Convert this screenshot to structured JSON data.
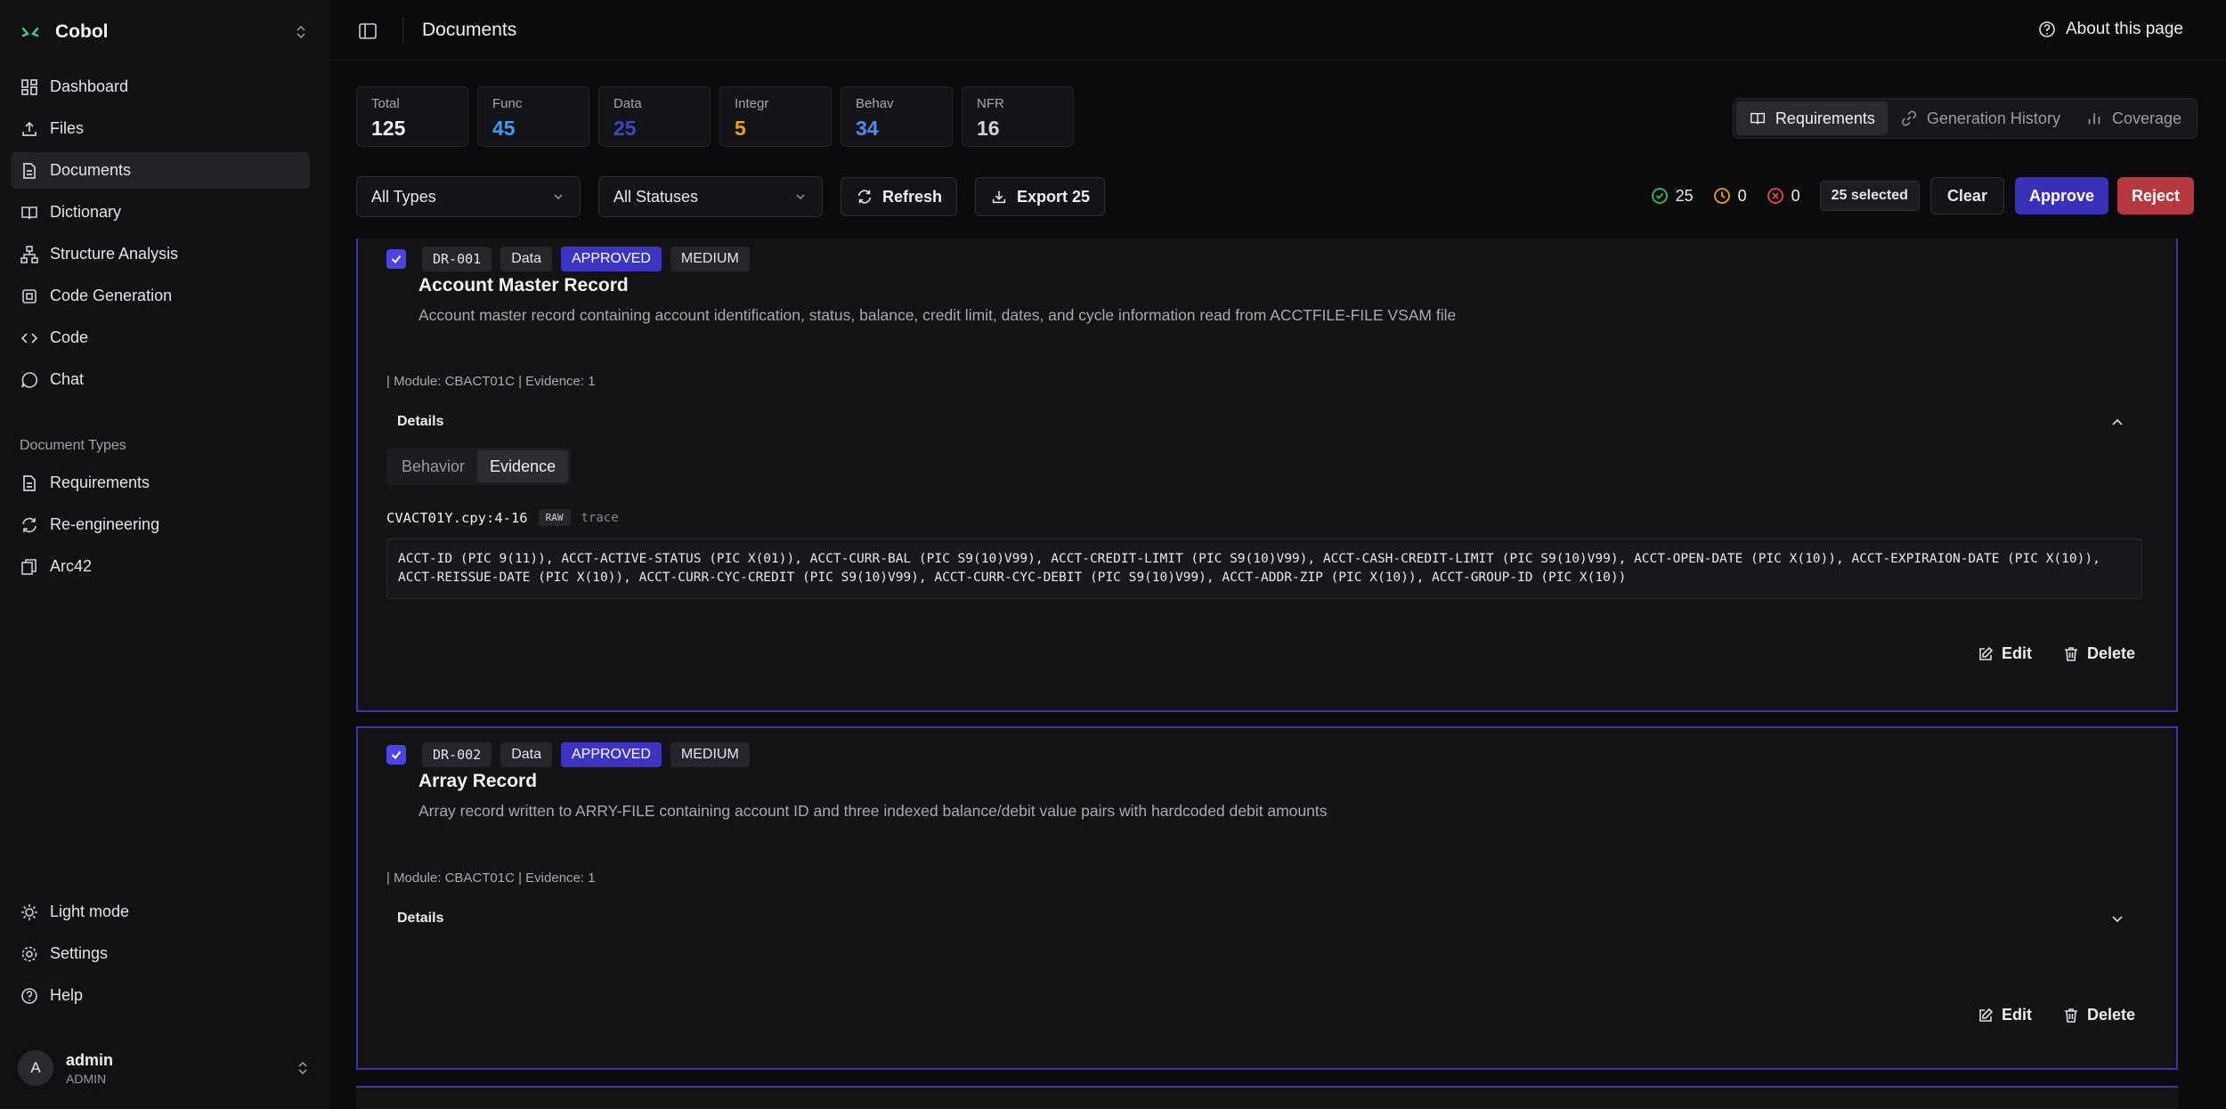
{
  "app": {
    "name": "Cobol"
  },
  "sidebar": {
    "items": [
      {
        "label": "Dashboard",
        "icon": "dashboard-icon"
      },
      {
        "label": "Files",
        "icon": "upload-icon"
      },
      {
        "label": "Documents",
        "icon": "document-icon",
        "active": true
      },
      {
        "label": "Dictionary",
        "icon": "book-icon"
      },
      {
        "label": "Structure Analysis",
        "icon": "structure-icon"
      },
      {
        "label": "Code Generation",
        "icon": "cpu-icon"
      },
      {
        "label": "Code",
        "icon": "code-icon"
      },
      {
        "label": "Chat",
        "icon": "chat-icon"
      }
    ],
    "section_label": "Document Types",
    "doc_types": [
      {
        "label": "Requirements",
        "icon": "document-icon"
      },
      {
        "label": "Re-engineering",
        "icon": "refresh-icon"
      },
      {
        "label": "Arc42",
        "icon": "layers-icon"
      }
    ],
    "bottom": [
      {
        "label": "Light mode",
        "icon": "sun-icon"
      },
      {
        "label": "Settings",
        "icon": "gear-icon"
      },
      {
        "label": "Help",
        "icon": "help-icon"
      }
    ],
    "user": {
      "initial": "A",
      "name": "admin",
      "role": "ADMIN"
    }
  },
  "header": {
    "title": "Documents",
    "about_label": "About this page"
  },
  "stats": [
    {
      "label": "Total",
      "value": "125",
      "color": "#f2f2f4"
    },
    {
      "label": "Func",
      "value": "45",
      "color": "#3b9cf0"
    },
    {
      "label": "Data",
      "value": "25",
      "color": "#3a48c8"
    },
    {
      "label": "Integr",
      "value": "5",
      "color": "#e8a21c"
    },
    {
      "label": "Behav",
      "value": "34",
      "color": "#4a8ef5"
    },
    {
      "label": "NFR",
      "value": "16",
      "color": "#d4d4d8"
    }
  ],
  "view_tabs": [
    {
      "label": "Requirements",
      "active": true
    },
    {
      "label": "Generation History"
    },
    {
      "label": "Coverage"
    }
  ],
  "filters": {
    "type_select": "All Types",
    "status_select": "All Statuses",
    "refresh_label": "Refresh",
    "export_label": "Export 25"
  },
  "bulk": {
    "approved_count": "25",
    "pending_count": "0",
    "rejected_count": "0",
    "selected_label": "25 selected",
    "clear_label": "Clear",
    "approve_label": "Approve",
    "reject_label": "Reject"
  },
  "colors": {
    "accent": "#3d34c4",
    "reject": "#b5393f",
    "approved_icon": "#2fbf5b",
    "pending_icon": "#e8a21c",
    "rejected_icon": "#e5484d"
  },
  "cards": [
    {
      "id": "DR-001",
      "type": "Data",
      "status": "APPROVED",
      "priority": "MEDIUM",
      "title": "Account Master Record",
      "description": "Account master record containing account identification, status, balance, credit limit, dates, and cycle information read from ACCTFILE-FILE VSAM file",
      "meta": "| Module: CBACT01C  | Evidence: 1",
      "details_label": "Details",
      "subtabs": [
        "Behavior",
        "Evidence"
      ],
      "evidence_file": "CVACT01Y.cpy:4-16",
      "evidence_raw": "RAW",
      "evidence_trace": "trace",
      "code": "ACCT-ID (PIC 9(11)), ACCT-ACTIVE-STATUS (PIC X(01)), ACCT-CURR-BAL (PIC S9(10)V99), ACCT-CREDIT-LIMIT (PIC S9(10)V99), ACCT-CASH-CREDIT-LIMIT (PIC S9(10)V99), ACCT-OPEN-DATE (PIC X(10)), ACCT-EXPIRAION-DATE (PIC X(10)), ACCT-REISSUE-DATE (PIC X(10)), ACCT-CURR-CYC-CREDIT (PIC S9(10)V99), ACCT-CURR-CYC-DEBIT (PIC S9(10)V99), ACCT-ADDR-ZIP (PIC X(10)), ACCT-GROUP-ID (PIC X(10))",
      "edit_label": "Edit",
      "delete_label": "Delete"
    },
    {
      "id": "DR-002",
      "type": "Data",
      "status": "APPROVED",
      "priority": "MEDIUM",
      "title": "Array Record",
      "description": "Array record written to ARRY-FILE containing account ID and three indexed balance/debit value pairs with hardcoded debit amounts",
      "meta": "| Module: CBACT01C  | Evidence: 1",
      "details_label": "Details",
      "edit_label": "Edit",
      "delete_label": "Delete"
    }
  ]
}
